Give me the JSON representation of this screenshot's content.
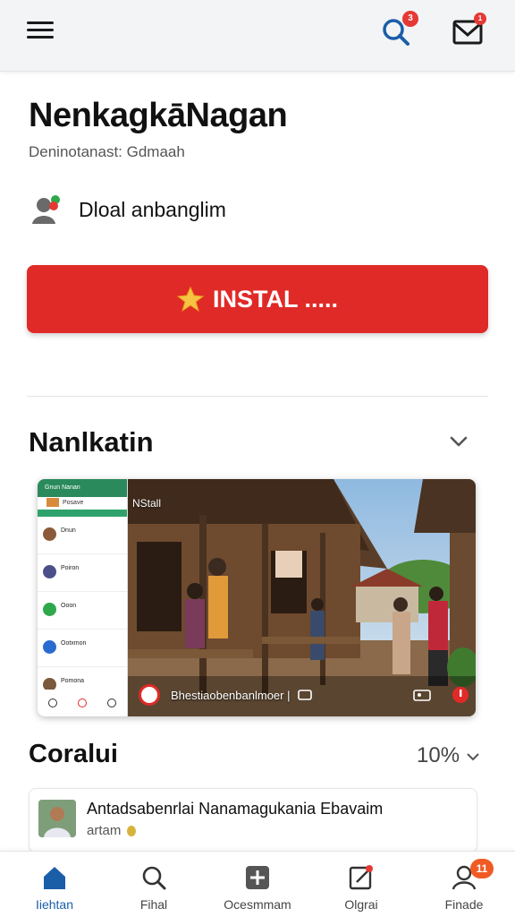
{
  "topbar": {
    "search_badge": "3",
    "mail_badge": "1"
  },
  "app": {
    "title": "NenkagkāNagan",
    "subtitle": "Deninotanast: Gdmaah",
    "developer": "Dloal anbanglim",
    "install_label": "INSTAL ....."
  },
  "sections": {
    "screenshots_title": "Nanlkatin",
    "ratings_title": "Coralui",
    "ratings_value": "10%"
  },
  "preview": {
    "phone_header": "Gnun  Nanan",
    "phone_sub": "Posave",
    "phone_items": [
      {
        "name": "Dnun",
        "color": "#8a5a3b"
      },
      {
        "name": "Poiron",
        "color": "#4a4f8a"
      },
      {
        "name": "Ooon",
        "color": "#2ea84a"
      },
      {
        "name": "Ootxmon",
        "color": "#2a6bd1"
      },
      {
        "name": "Pomona",
        "color": "#7a5a3a"
      }
    ],
    "scene_label": "NStall",
    "caption": "Bhestiaobenbanlmoer |"
  },
  "review": {
    "title": "Antadsabenrlai Nanamagukania Ebavaim",
    "meta": "artam"
  },
  "bottom_nav": [
    {
      "label": "Iiehtan",
      "icon": "home-icon"
    },
    {
      "label": "Fihal",
      "icon": "search-icon"
    },
    {
      "label": "Ocesmmam",
      "icon": "add-icon"
    },
    {
      "label": "Olgrai",
      "icon": "edit-icon"
    },
    {
      "label": "Finade",
      "icon": "profile-icon",
      "badge": "11"
    }
  ],
  "colors": {
    "accent_red": "#e02a27",
    "nav_active": "#1a5ea8",
    "badge_red": "#e53935"
  }
}
